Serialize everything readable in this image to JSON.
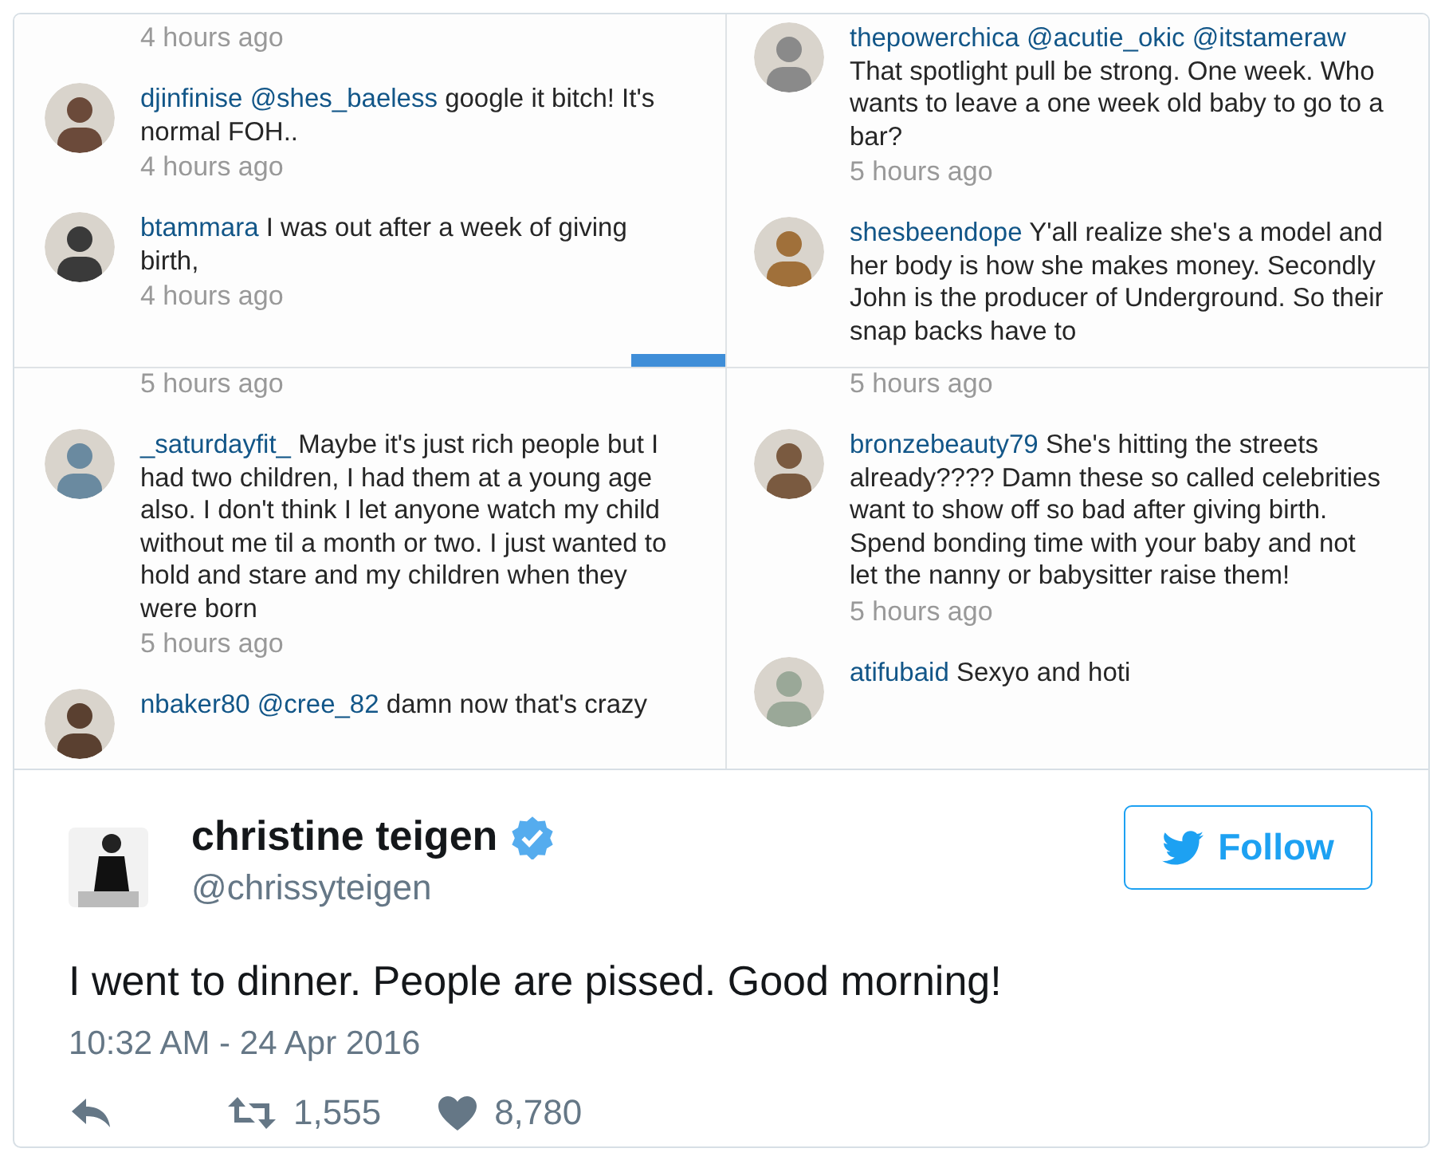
{
  "instagram_panels": [
    {
      "leading_time": "4 hours ago",
      "progress_marker": true,
      "comments": [
        {
          "username": "djinfinise",
          "mentions": [
            "@shes_baeless"
          ],
          "text": "google it bitch! It's normal FOH..",
          "time": "4 hours ago"
        },
        {
          "username": "btammara",
          "text": "I was out after a week of giving birth,",
          "time": "4 hours ago"
        }
      ]
    },
    {
      "progress_marker": false,
      "comments": [
        {
          "username": "thepowerchica",
          "mentions": [
            "@acutie_okic",
            "@itstameraw"
          ],
          "text": "That spotlight pull be strong. One week. Who wants to leave a one week old baby to go to a bar?",
          "time": "5 hours ago"
        },
        {
          "username": "shesbeendope",
          "text": "Y'all realize she's a model and her body is how she makes money. Secondly John is the producer of Underground. So their snap backs have to"
        }
      ]
    },
    {
      "leading_time": "5 hours ago",
      "progress_marker": false,
      "comments": [
        {
          "username": "_saturdayfit_",
          "text": "Maybe it's just rich people but I had two children, I had them at a young age also. I don't think I let anyone watch my child without me til a month or two. I just wanted to hold and stare and my children when they were born",
          "time": "5 hours ago"
        },
        {
          "username": "nbaker80",
          "mentions": [
            "@cree_82"
          ],
          "text": "damn now that's crazy"
        }
      ]
    },
    {
      "leading_time": "5 hours ago",
      "progress_marker": false,
      "comments": [
        {
          "username": "bronzebeauty79",
          "text": "She's hitting the streets already???? Damn these so called celebrities want to show off so bad after giving birth. Spend bonding time with your baby and not let the nanny or babysitter raise them!",
          "time": "5 hours ago"
        },
        {
          "username": "atifubaid",
          "text": "Sexyo and hoti"
        }
      ]
    }
  ],
  "tweet": {
    "name": "christine teigen",
    "verified": true,
    "handle": "@chrissyteigen",
    "follow_label": "Follow",
    "text": "I went to dinner. People are pissed. Good morning!",
    "timestamp": "10:32 AM - 24 Apr 2016",
    "retweets": "1,555",
    "likes": "8,780"
  }
}
